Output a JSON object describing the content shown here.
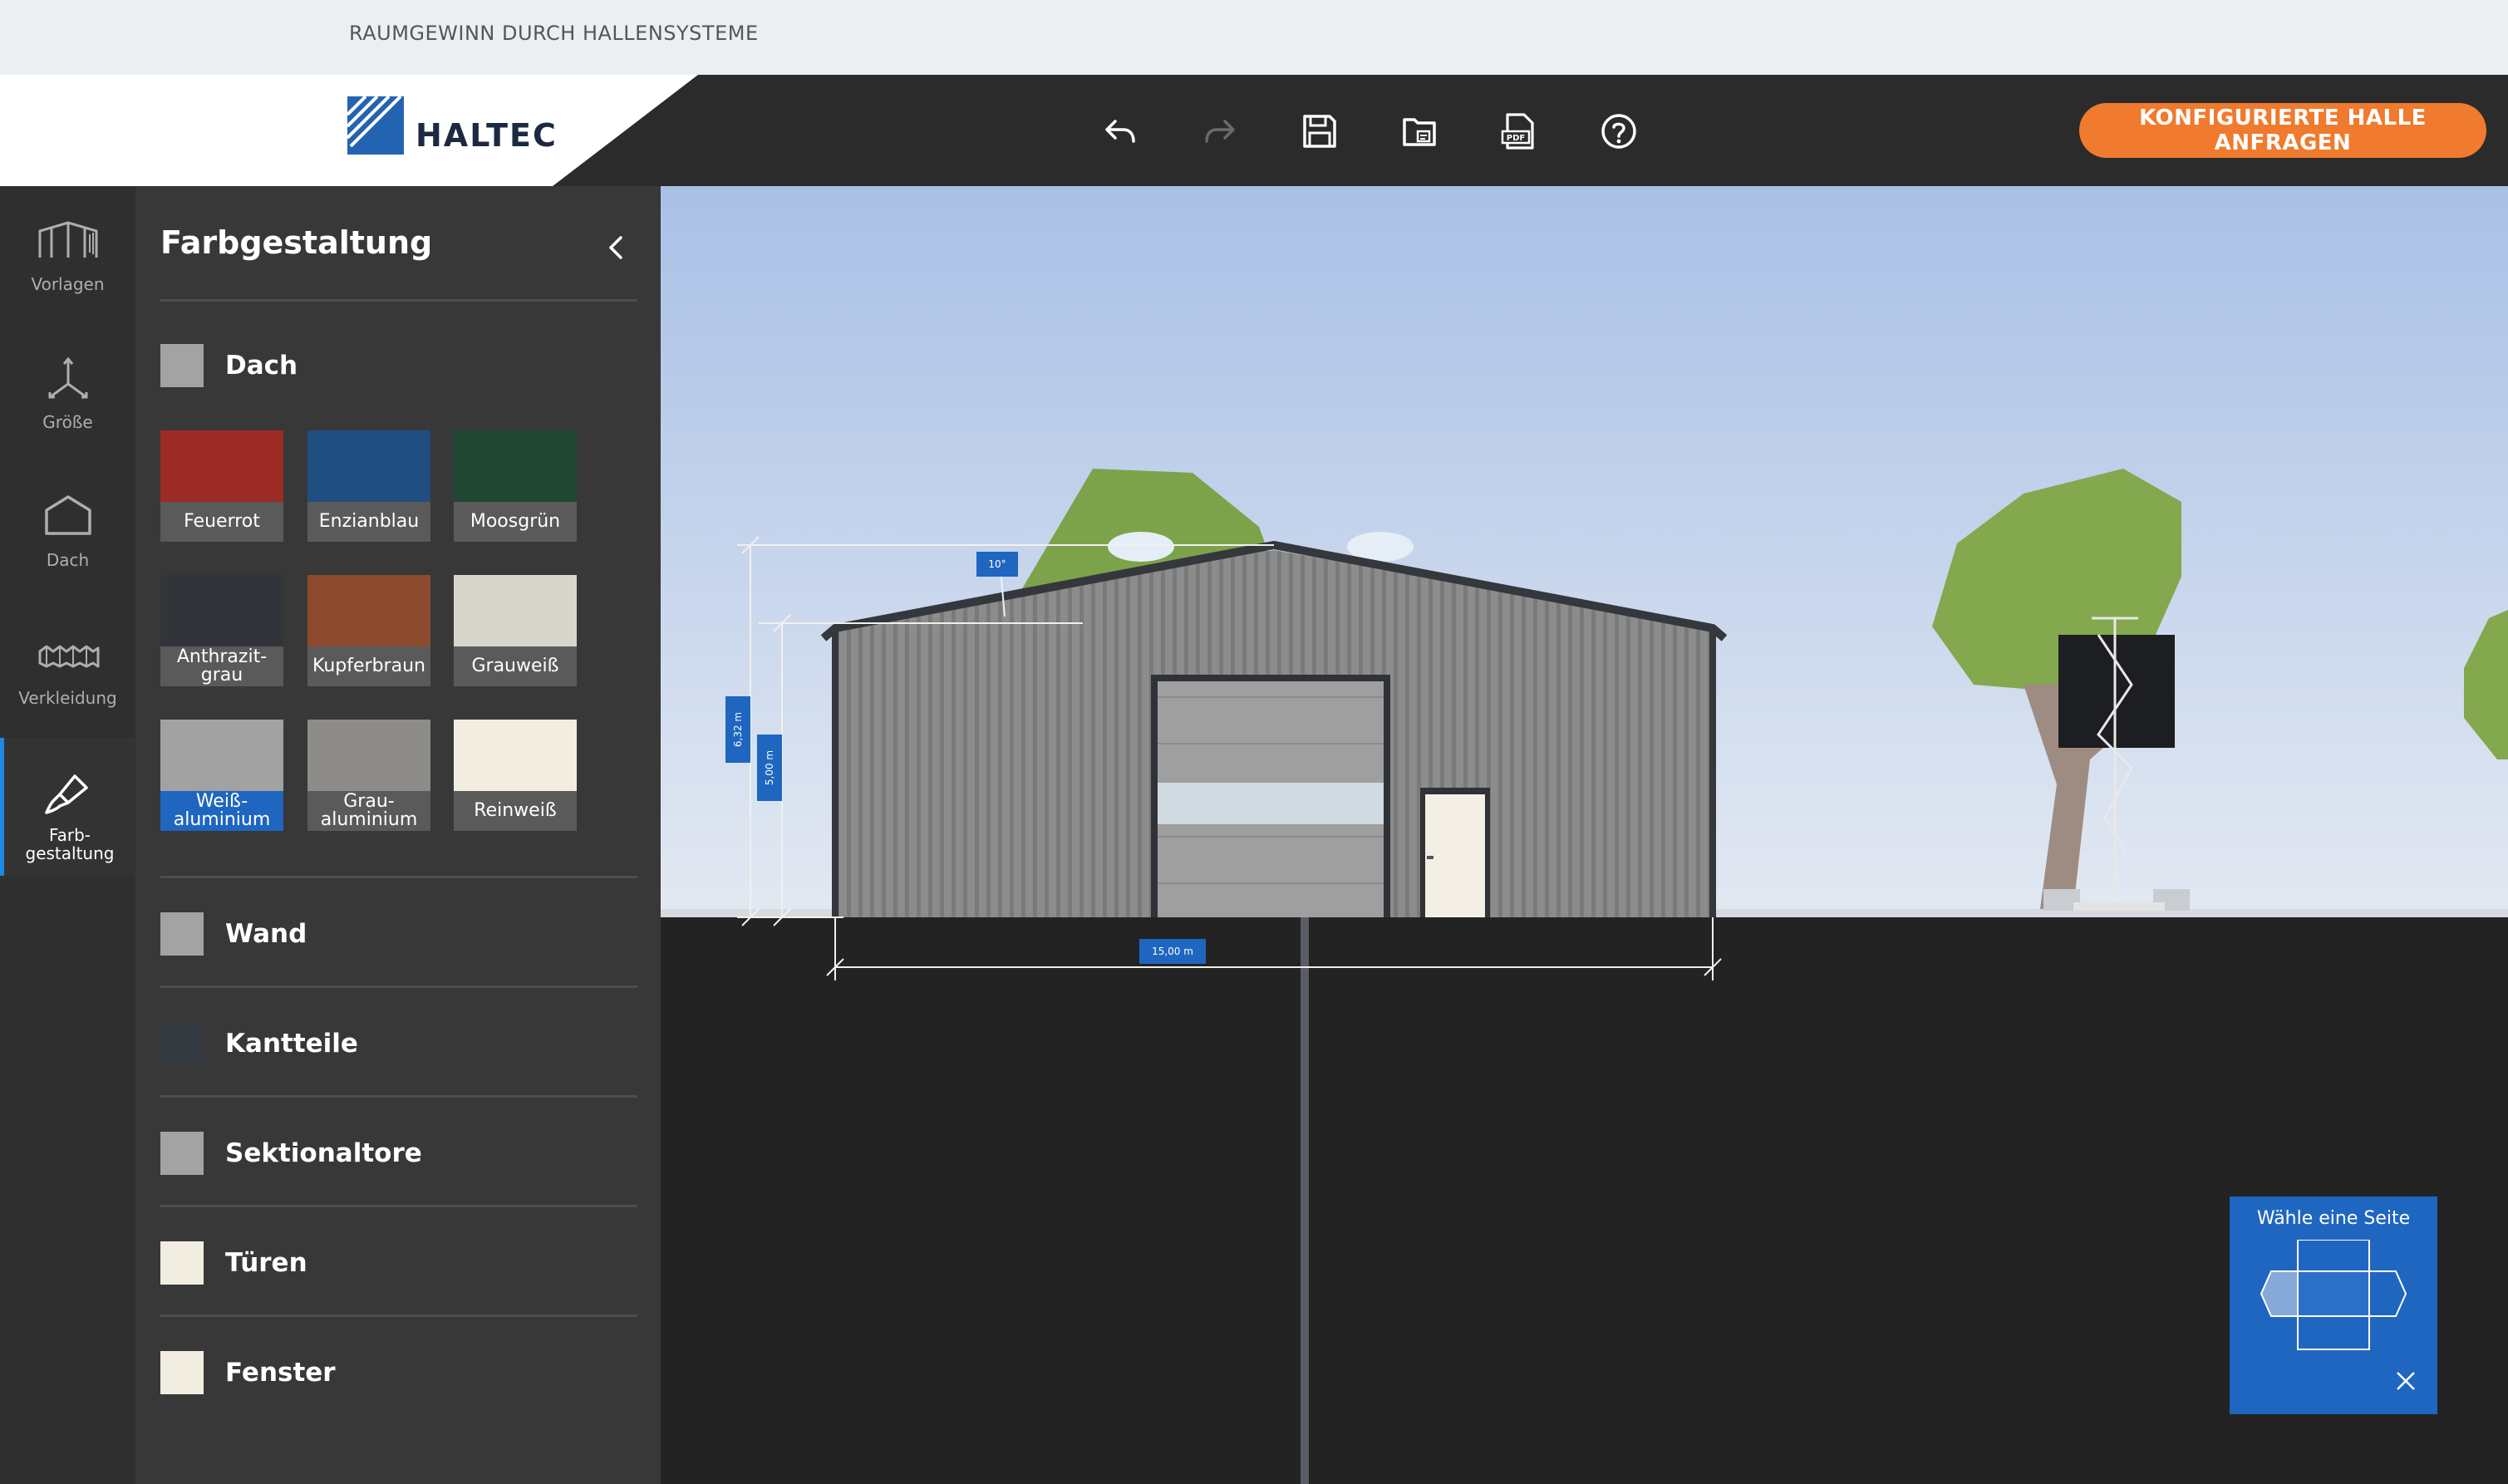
{
  "topbar": {
    "tagline": "RAUMGEWINN DURCH HALLENSYSTEME"
  },
  "header": {
    "logo_text": "HALTEC",
    "cta_label": "KONFIGURIERTE HALLE ANFRAGEN",
    "tools": [
      "undo-icon",
      "redo-icon",
      "save-icon",
      "open-file-icon",
      "pdf-icon",
      "help-icon"
    ]
  },
  "nav": {
    "items": [
      {
        "label": "Vorlagen",
        "icon": "templates-icon"
      },
      {
        "label": "Größe",
        "icon": "size-axes-icon"
      },
      {
        "label": "Dach",
        "icon": "roof-icon"
      },
      {
        "label": "Verkleidung",
        "icon": "cladding-icon"
      },
      {
        "label": "Farb-\ngestaltung",
        "icon": "paint-brush-icon"
      }
    ]
  },
  "panel": {
    "title": "Farbgestaltung",
    "sections": [
      {
        "label": "Dach",
        "swatch_color": "#a3a3a3"
      },
      {
        "label": "Wand",
        "swatch_color": "#a3a3a3"
      },
      {
        "label": "Kantteile",
        "swatch_color": "#353a40"
      },
      {
        "label": "Sektionaltore",
        "swatch_color": "#a3a3a3"
      },
      {
        "label": "Türen",
        "swatch_color": "#f1ede1"
      },
      {
        "label": "Fenster",
        "swatch_color": "#f1ede1"
      }
    ],
    "colors": [
      {
        "label": "Feuerrot",
        "color": "#9b2b24"
      },
      {
        "label": "Enzianblau",
        "color": "#1f4d7f"
      },
      {
        "label": "Moosgrün",
        "color": "#1f4734"
      },
      {
        "label": "Anthrazit-\ngrau",
        "color": "#31353a"
      },
      {
        "label": "Kupferbraun",
        "color": "#8c4a2f"
      },
      {
        "label": "Grauweiß",
        "color": "#d8d5cc"
      },
      {
        "label": "Weiß-\naluminium",
        "color": "#a2a2a2"
      },
      {
        "label": "Grau-\naluminium",
        "color": "#8d8c89"
      },
      {
        "label": "Reinweiß",
        "color": "#f1ede1"
      }
    ],
    "selected_color": "Weiß-\naluminium"
  },
  "scene": {
    "dim_width": "15,00 m",
    "dim_height_total": "6,32 m",
    "dim_height_eave": "5,00 m",
    "roof_angle": "10°"
  },
  "side_picker": {
    "title": "Wähle eine Seite"
  },
  "colors": {
    "accent": "#f07a2d",
    "blue": "#1f66c0",
    "dark": "#2b2b2b"
  }
}
